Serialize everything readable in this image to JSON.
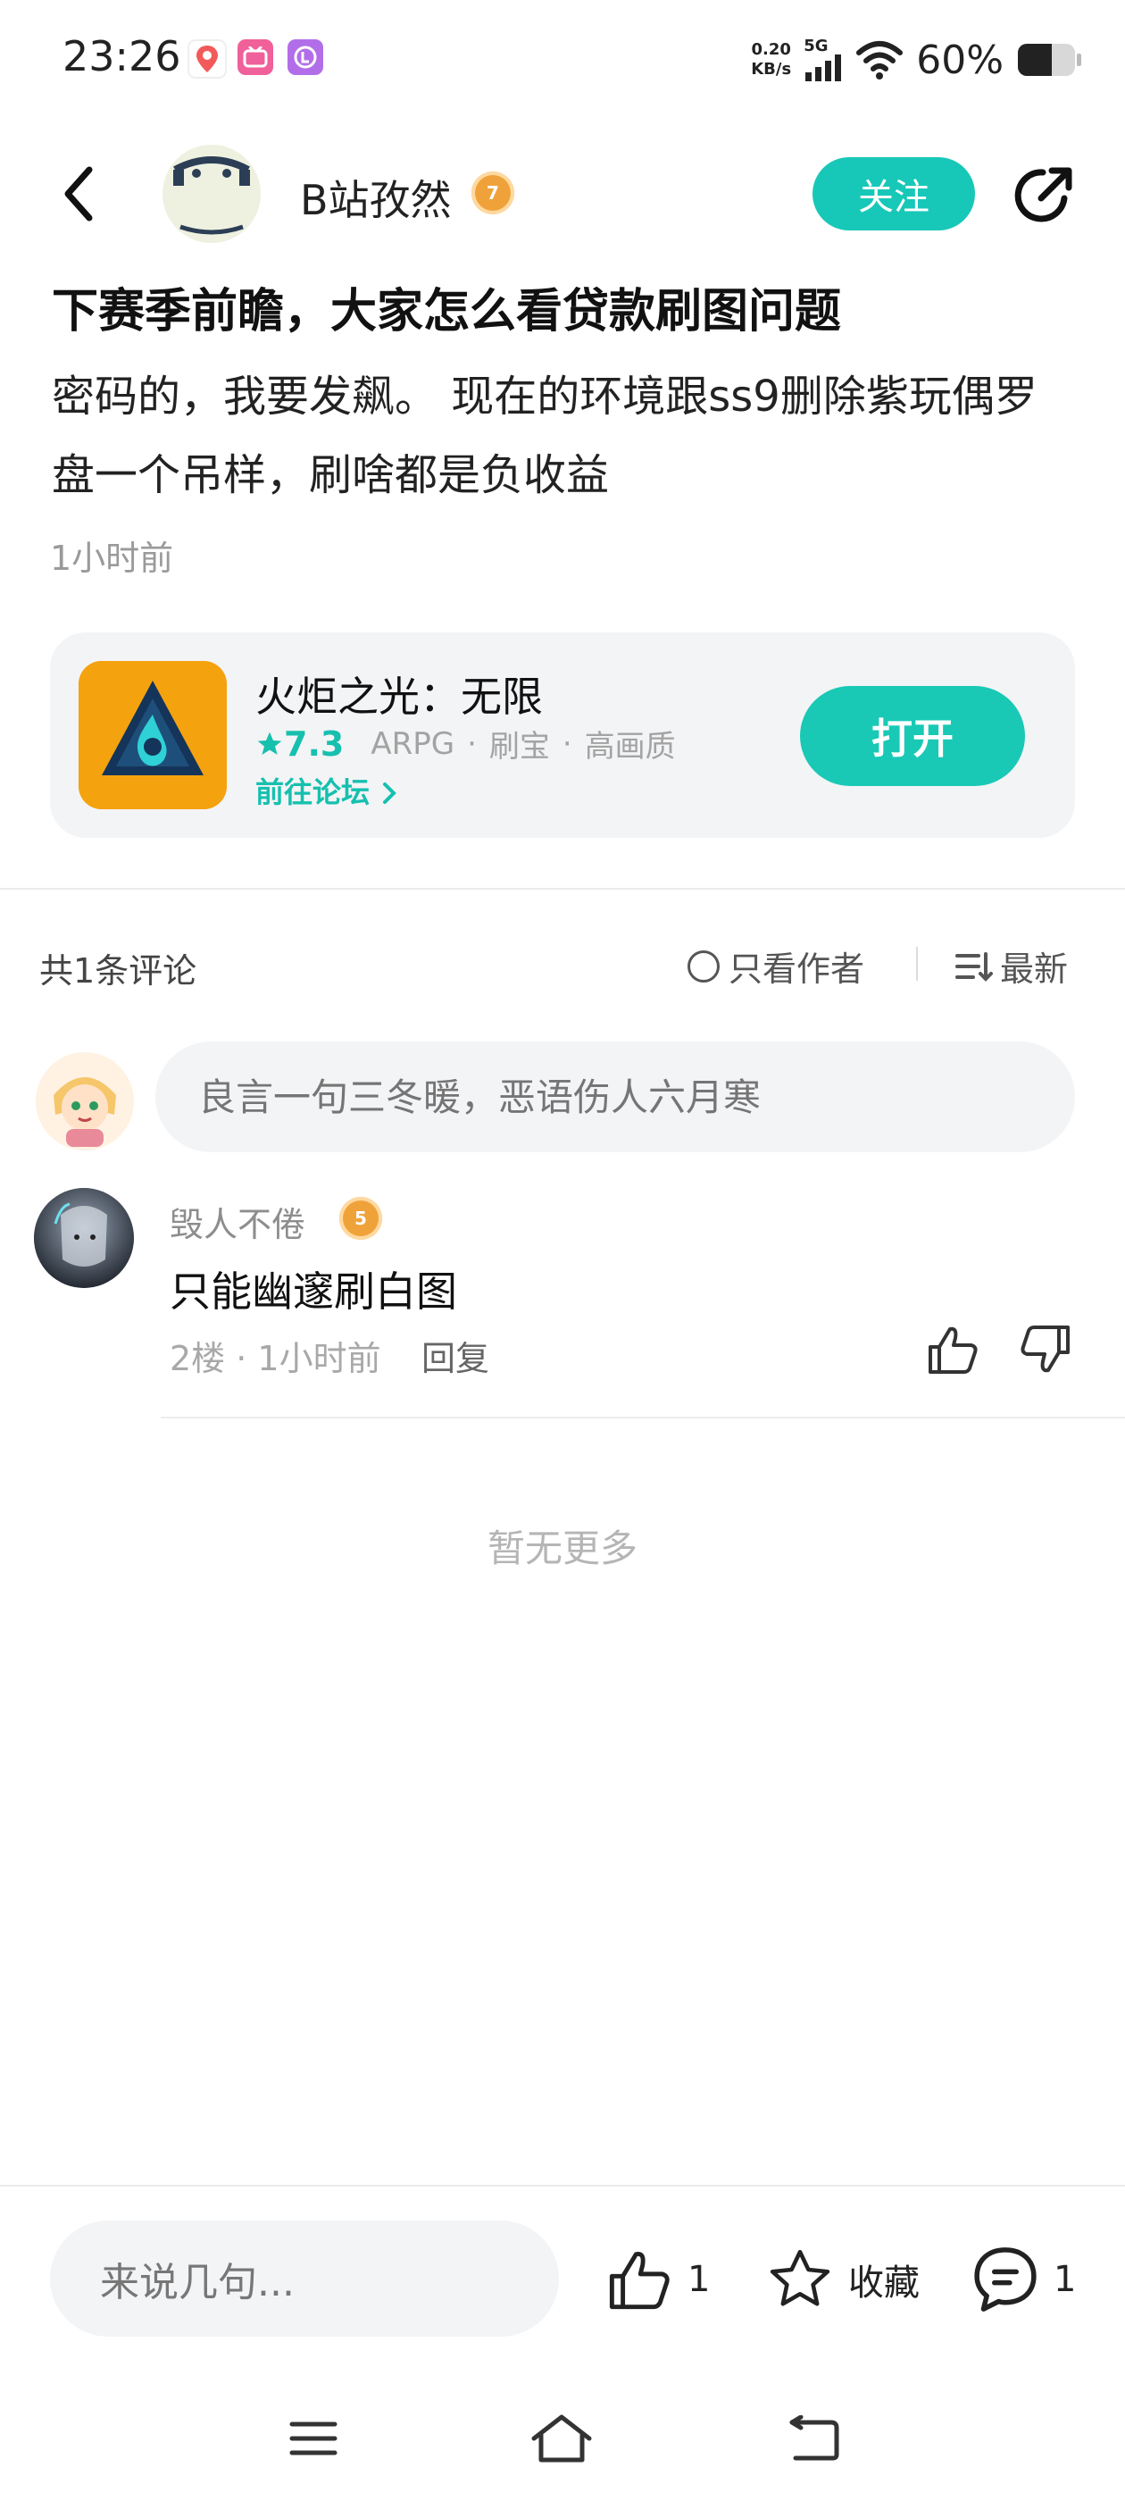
{
  "status_bar": {
    "time": "23:26",
    "net_speed_value": "0.20",
    "net_speed_unit": "KB/s",
    "network": "5G",
    "battery": "60%"
  },
  "header": {
    "author_name": "B站孜然",
    "author_level": "7",
    "follow_label": "关注"
  },
  "post": {
    "title": "下赛季前瞻，大家怎么看贷款刷图问题",
    "body": "密码的，我要发飙。 现在的环境跟ss9删除紫玩偶罗盘一个吊样，刷啥都是负收益",
    "time": "1小时前"
  },
  "app_card": {
    "name": "火炬之光：无限",
    "rating": "7.3",
    "tags": [
      "ARPG",
      "刷宝",
      "高画质"
    ],
    "forum_link": "前往论坛",
    "open_label": "打开"
  },
  "comments_header": {
    "count_text": "共1条评论",
    "author_only": "只看作者",
    "sort": "最新"
  },
  "comment_input": {
    "placeholder": "良言一句三冬暖，恶语伤人六月寒"
  },
  "comments": [
    {
      "user": "毁人不倦",
      "level": "5",
      "text": "只能幽邃刷白图",
      "meta": "2楼 · 1小时前",
      "reply": "回复"
    }
  ],
  "no_more": "暂无更多",
  "bottom_bar": {
    "input_placeholder": "来说几句...",
    "like_count": "1",
    "favorite_label": "收藏",
    "comment_count": "1"
  },
  "colors": {
    "accent": "#17c8b8",
    "badge_gold": "#f0a23a"
  }
}
